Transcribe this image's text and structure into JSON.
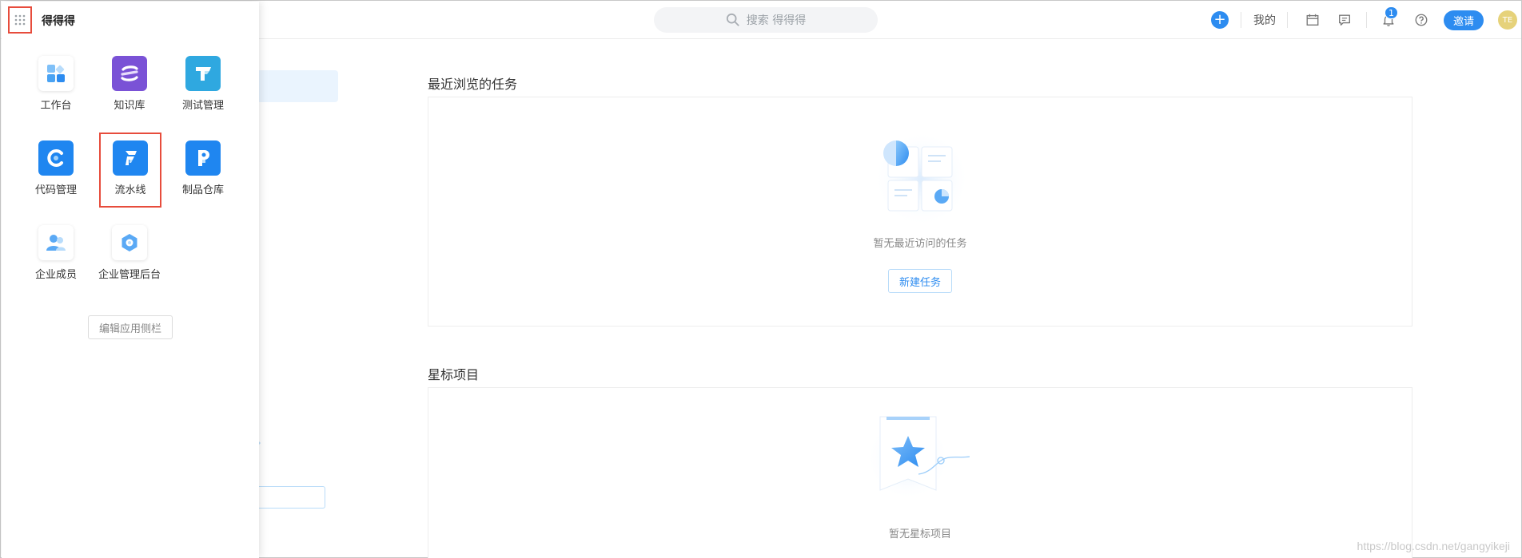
{
  "drawer": {
    "title": "得得得",
    "apps": [
      {
        "label": "工作台",
        "icon": "workbench-icon"
      },
      {
        "label": "知识库",
        "icon": "knowledge-base-icon"
      },
      {
        "label": "测试管理",
        "icon": "test-management-icon"
      },
      {
        "label": "代码管理",
        "icon": "code-management-icon"
      },
      {
        "label": "流水线",
        "icon": "pipeline-icon",
        "selected": true
      },
      {
        "label": "制品仓库",
        "icon": "artifact-repo-icon"
      },
      {
        "label": "企业成员",
        "icon": "members-icon"
      },
      {
        "label": "企业管理后台",
        "icon": "admin-console-icon"
      }
    ],
    "edit_label": "编辑应用侧栏"
  },
  "header": {
    "search_placeholder": "搜索 得得得",
    "mine_label": "我的",
    "notification_count": "1",
    "invite_label": "邀请",
    "avatar_text": "TE"
  },
  "main": {
    "recent_title": "最近浏览的任务",
    "recent_empty": "暂无最近访问的任务",
    "new_task_label": "新建任务",
    "starred_title": "星标项目",
    "starred_empty": "暂无星标项目"
  },
  "watermark": "https://blog.csdn.net/gangyikeji",
  "colors": {
    "accent": "#2d8cf0",
    "highlight_border": "#e74c3c"
  }
}
